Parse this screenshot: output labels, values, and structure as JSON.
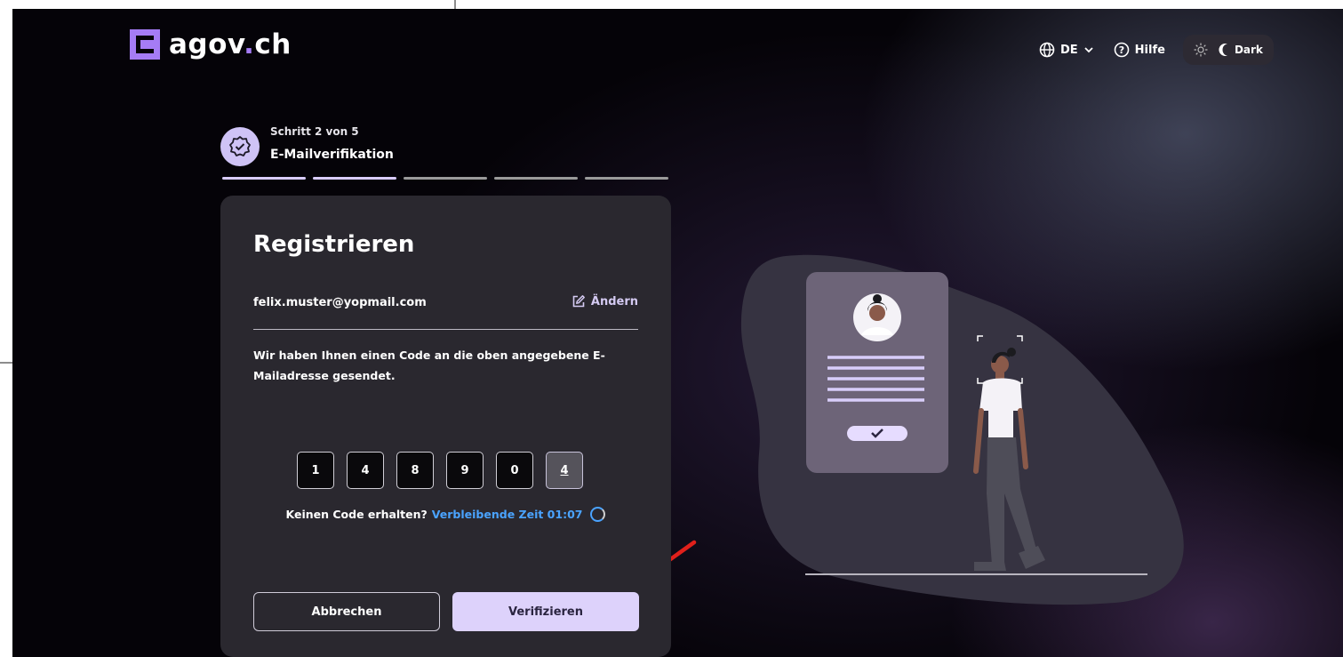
{
  "header": {
    "logo_main": "agov",
    "logo_dot": ".",
    "logo_tld": "ch",
    "language": "DE",
    "help_label": "Hilfe",
    "theme_label": "Dark"
  },
  "stepper": {
    "step_text": "Schritt 2 von 5",
    "step_title": "E-Mailverifikation",
    "total_steps": 5,
    "completed_steps": 2
  },
  "card": {
    "title": "Registrieren",
    "email": "felix.muster@yopmail.com",
    "edit_label": "Ändern",
    "info_text": "Wir haben Ihnen einen Code an die oben angegebene E-Mailadresse gesendet.",
    "otp_digits": [
      "1",
      "4",
      "8",
      "9",
      "0",
      "4"
    ],
    "resend_question": "Keinen Code erhalten?",
    "resend_timer": "Verbleibende Zeit 01:07",
    "cancel_label": "Abbrechen",
    "verify_label": "Verifizieren"
  },
  "colors": {
    "accent": "#ddd2fb",
    "link": "#4aa3ff",
    "card_bg": "#2a282f",
    "annotation_arrow": "#e0201b"
  },
  "icons": [
    "globe-icon",
    "chevron-down-icon",
    "help-icon",
    "sun-icon",
    "moon-icon",
    "verified-badge-icon",
    "edit-icon",
    "spinner-icon"
  ]
}
